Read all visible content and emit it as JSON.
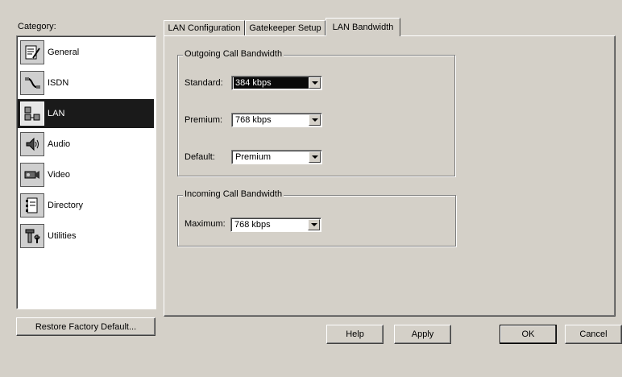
{
  "category": {
    "label": "Category:",
    "items": [
      {
        "label": "General",
        "icon": "general-icon",
        "selected": false
      },
      {
        "label": "ISDN",
        "icon": "isdn-icon",
        "selected": false
      },
      {
        "label": "LAN",
        "icon": "lan-icon",
        "selected": true
      },
      {
        "label": "Audio",
        "icon": "audio-icon",
        "selected": false
      },
      {
        "label": "Video",
        "icon": "video-icon",
        "selected": false
      },
      {
        "label": "Directory",
        "icon": "directory-icon",
        "selected": false
      },
      {
        "label": "Utilities",
        "icon": "utilities-icon",
        "selected": false
      }
    ]
  },
  "restore_button": "Restore Factory Default...",
  "tabs": [
    {
      "label": "LAN Configuration",
      "active": false
    },
    {
      "label": "Gatekeeper Setup",
      "active": false
    },
    {
      "label": "LAN Bandwidth",
      "active": true
    }
  ],
  "outgoing": {
    "title": "Outgoing Call Bandwidth",
    "standard_label": "Standard:",
    "standard_value": "384 kbps",
    "premium_label": "Premium:",
    "premium_value": "768 kbps",
    "default_label": "Default:",
    "default_value": "Premium"
  },
  "incoming": {
    "title": "Incoming Call Bandwidth",
    "maximum_label": "Maximum:",
    "maximum_value": "768 kbps"
  },
  "buttons": {
    "help": "Help",
    "apply": "Apply",
    "ok": "OK",
    "cancel": "Cancel"
  },
  "colors": {
    "dialog_bg": "#d4d0c8",
    "selection": "#1a1a1a"
  }
}
